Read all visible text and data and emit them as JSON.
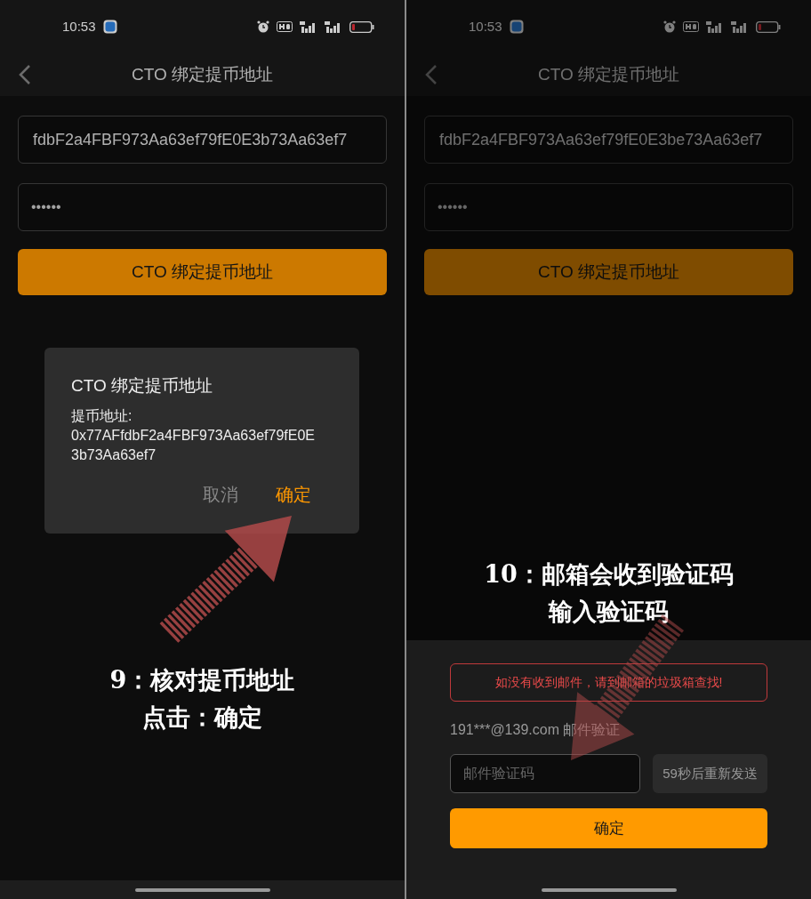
{
  "panels": [
    {
      "kind": "dialog",
      "status_bar": {
        "time": "10:53"
      },
      "nav": {
        "title": "CTO 绑定提币地址"
      },
      "address_field": {
        "value": "fdbF2a4FBF973Aa63ef79fE0E3b73Aa63ef7"
      },
      "password_field": {
        "value": "••••••"
      },
      "submit_button": {
        "label": "CTO 绑定提币地址"
      },
      "dialog": {
        "title": "CTO 绑定提币地址",
        "label": "提币地址:",
        "address": "0x77AFfdbF2a4FBF973Aa63ef79fE0E3b73Aa63ef7",
        "buttons": [
          {
            "label": "取消",
            "primary": false
          },
          {
            "label": "确定",
            "primary": true
          }
        ]
      },
      "caption": [
        "9：核对提币地址",
        "点击：确定"
      ]
    },
    {
      "kind": "sheet",
      "status_bar": {
        "time": "10:53"
      },
      "nav": {
        "title": "CTO 绑定提币地址"
      },
      "address_field": {
        "value": "fdbF2a4FBF973Aa63ef79fE0E3be73Aa63ef7"
      },
      "password_field": {
        "value": "••••••"
      },
      "submit_button": {
        "label": "CTO 绑定提币地址"
      },
      "sheet": {
        "notice": "如没有收到邮件，请到邮箱的垃圾箱查找!",
        "email_line": "191***@139.com 邮件验证",
        "code_field": {
          "placeholder": "邮件验证码"
        },
        "resend_button": {
          "label": "59秒后重新发送"
        },
        "confirm_button": {
          "label": "确定"
        }
      },
      "caption": [
        "10：邮箱会收到验证码",
        "输入验证码"
      ]
    }
  ]
}
